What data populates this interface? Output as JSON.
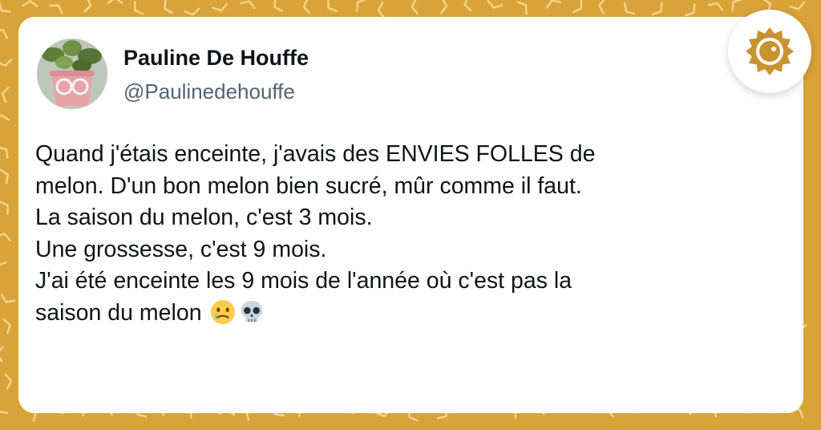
{
  "tweet": {
    "author": {
      "display_name": "Pauline De Houffe",
      "handle": "@Paulinedehouffe",
      "avatar_icon": "avatar-plant-glasses-icon"
    },
    "lines": [
      "Quand j'étais enceinte, j'avais des ENVIES FOLLES de",
      "melon. D'un bon melon bien sucré, mûr comme il faut.",
      "La saison du melon, c'est 3 mois.",
      "Une grossesse, c'est 9 mois.",
      "J'ai été enceinte les 9 mois de l'année où c'est pas la",
      "saison du melon"
    ],
    "trailing_emojis": [
      "face-holding-back-tears-icon",
      "skull-icon"
    ]
  },
  "brand": {
    "icon": "sun-logo-icon",
    "color": "#c8942f"
  },
  "colors": {
    "background": "#d8a338",
    "card": "#ffffff",
    "text": "#0f1419",
    "muted": "#536471"
  }
}
